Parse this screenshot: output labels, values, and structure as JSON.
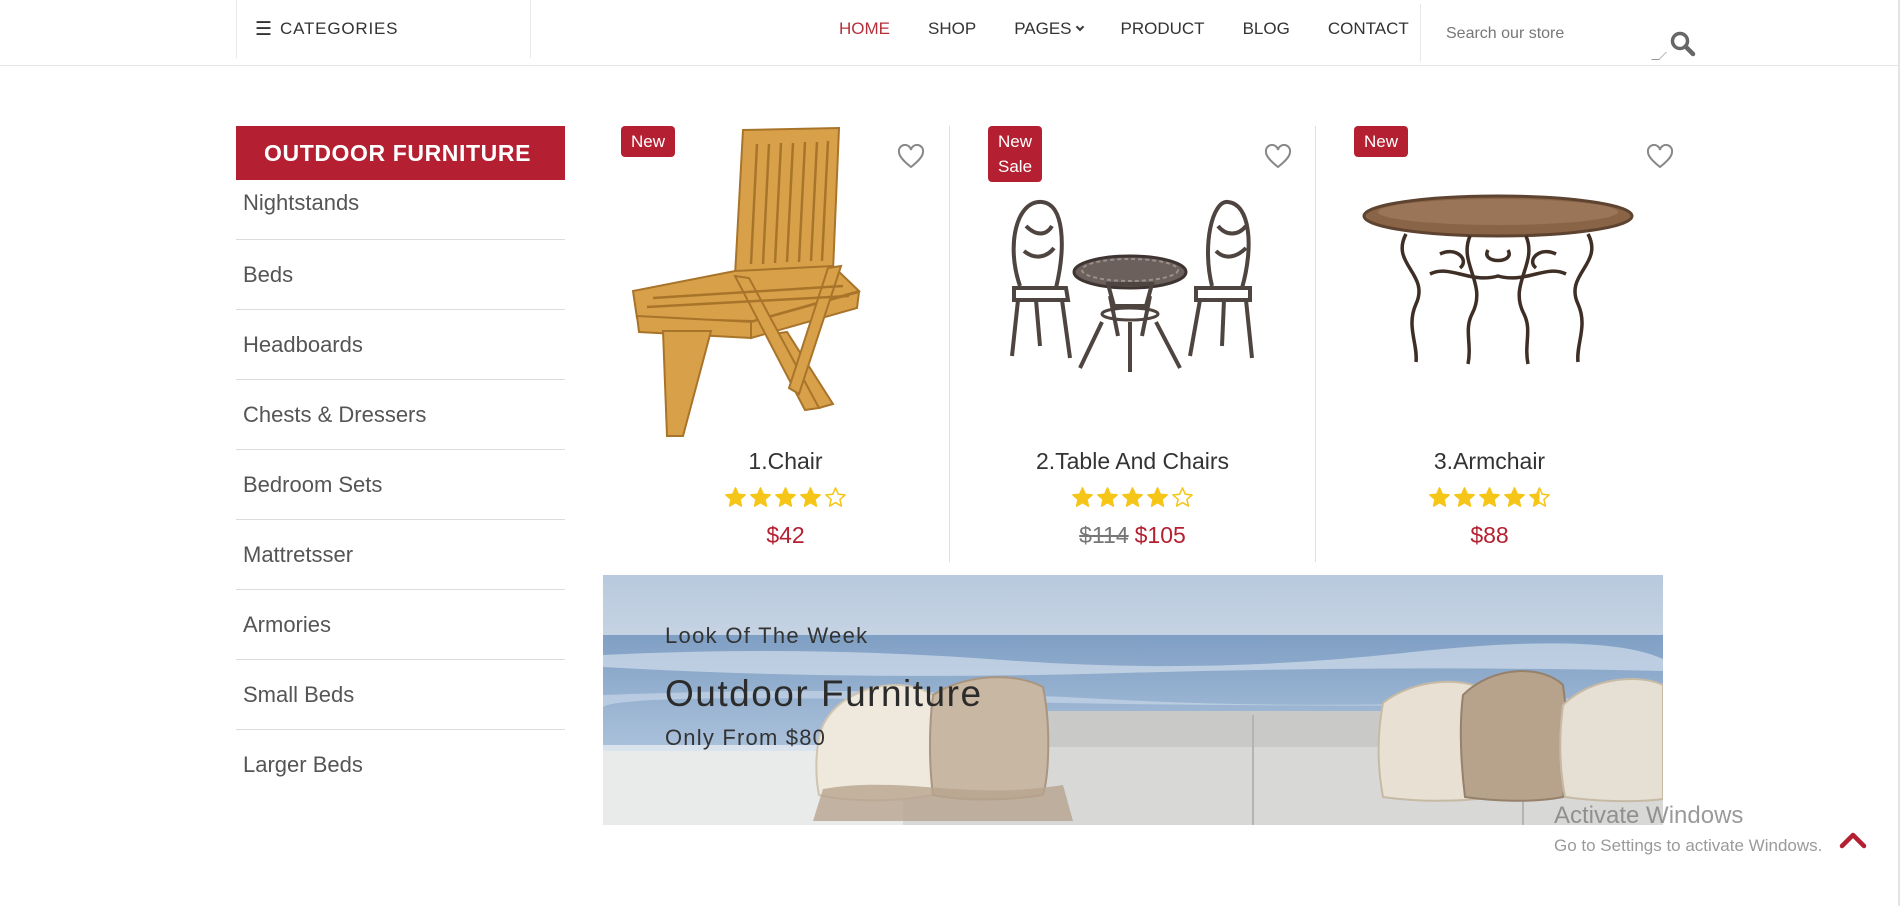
{
  "header": {
    "categories_label": "CATEGORIES",
    "nav": [
      {
        "label": "HOME",
        "active": true
      },
      {
        "label": "SHOP"
      },
      {
        "label": "PAGES",
        "has_dropdown": true
      },
      {
        "label": "PRODUCT"
      },
      {
        "label": "BLOG"
      },
      {
        "label": "CONTACT"
      }
    ],
    "search": {
      "placeholder": "Search our store",
      "value": "",
      "icon": "search-icon"
    }
  },
  "sidebar": {
    "title": "OUTDOOR FURNITURE",
    "items": [
      {
        "label": "Nightstands"
      },
      {
        "label": "Beds"
      },
      {
        "label": "Headboards"
      },
      {
        "label": "Chests & Dressers"
      },
      {
        "label": "Bedroom Sets"
      },
      {
        "label": "Mattretsser"
      },
      {
        "label": "Armories"
      },
      {
        "label": "Small Beds"
      },
      {
        "label": "Larger Beds"
      }
    ]
  },
  "products": [
    {
      "name": "1.Chair",
      "badges": [
        "New"
      ],
      "rating": 4,
      "price": "$42",
      "old_price": "",
      "wishlist_icon": "heart-icon"
    },
    {
      "name": "2.Table And Chairs",
      "badges": [
        "New",
        "Sale"
      ],
      "rating": 4,
      "price": "$105",
      "old_price": "$114",
      "wishlist_icon": "heart-icon"
    },
    {
      "name": "3.Armchair",
      "badges": [
        "New"
      ],
      "rating": 4.5,
      "price": "$88",
      "old_price": "",
      "wishlist_icon": "heart-icon"
    }
  ],
  "banner": {
    "tag": "Look Of The Week",
    "title": "Outdoor Furniture",
    "subtitle": "Only From $80"
  },
  "watermark": {
    "line1": "Activate Windows",
    "line2": "Go to Settings to activate Windows."
  },
  "colors": {
    "accent": "#b42031",
    "nav_active": "#b5303c",
    "star": "#f5c518"
  },
  "icons": {
    "menu": "menu-icon",
    "scroll_top": "chevron-up-icon"
  }
}
